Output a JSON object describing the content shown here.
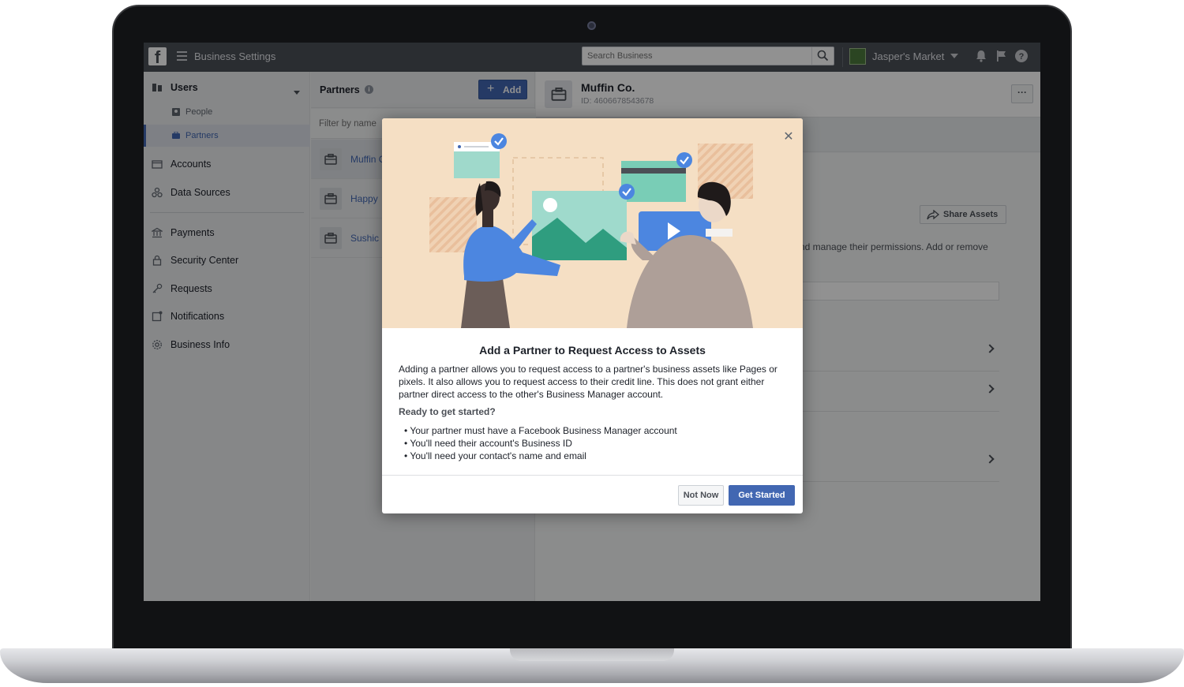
{
  "topbar": {
    "logo": "f",
    "app_title": "Business Settings",
    "search_placeholder": "Search Business",
    "business_name": "Jasper's Market"
  },
  "sidebar": {
    "section": "Users",
    "sub_items": [
      {
        "label": "People"
      },
      {
        "label": "Partners"
      }
    ],
    "items": [
      {
        "label": "Accounts"
      },
      {
        "label": "Data Sources"
      },
      {
        "label": "Payments"
      },
      {
        "label": "Security Center"
      },
      {
        "label": "Requests"
      },
      {
        "label": "Notifications"
      },
      {
        "label": "Business Info"
      }
    ]
  },
  "partners": {
    "title": "Partners",
    "add_label": "Add",
    "filter_placeholder": "Filter by name",
    "rows": [
      {
        "name": "Muffin Co."
      },
      {
        "name": "Happy"
      },
      {
        "name": "Sushic"
      }
    ]
  },
  "detail": {
    "name": "Muffin Co.",
    "id": "ID: 4606678543678",
    "more_label": "···",
    "share_label": "Share Assets",
    "desc": "nd manage their permissions. Add or remove"
  },
  "modal": {
    "title": "Add a Partner to Request Access to Assets",
    "text": "Adding a partner allows you to request access to a partner's business assets like Pages or pixels. It also allows you to request access to their credit line. This does not grant either partner direct access to the other's Business Manager account.",
    "subtitle": "Ready to get started?",
    "list": [
      "Your partner must have a Facebook Business Manager account",
      "You'll need their account's Business ID",
      "You'll need your contact's name and email"
    ],
    "not_now": "Not Now",
    "get_started": "Get Started"
  },
  "colors": {
    "accent": "#4267b2",
    "topbar": "#4b4f56",
    "hero_bg": "#f5dfc4"
  }
}
